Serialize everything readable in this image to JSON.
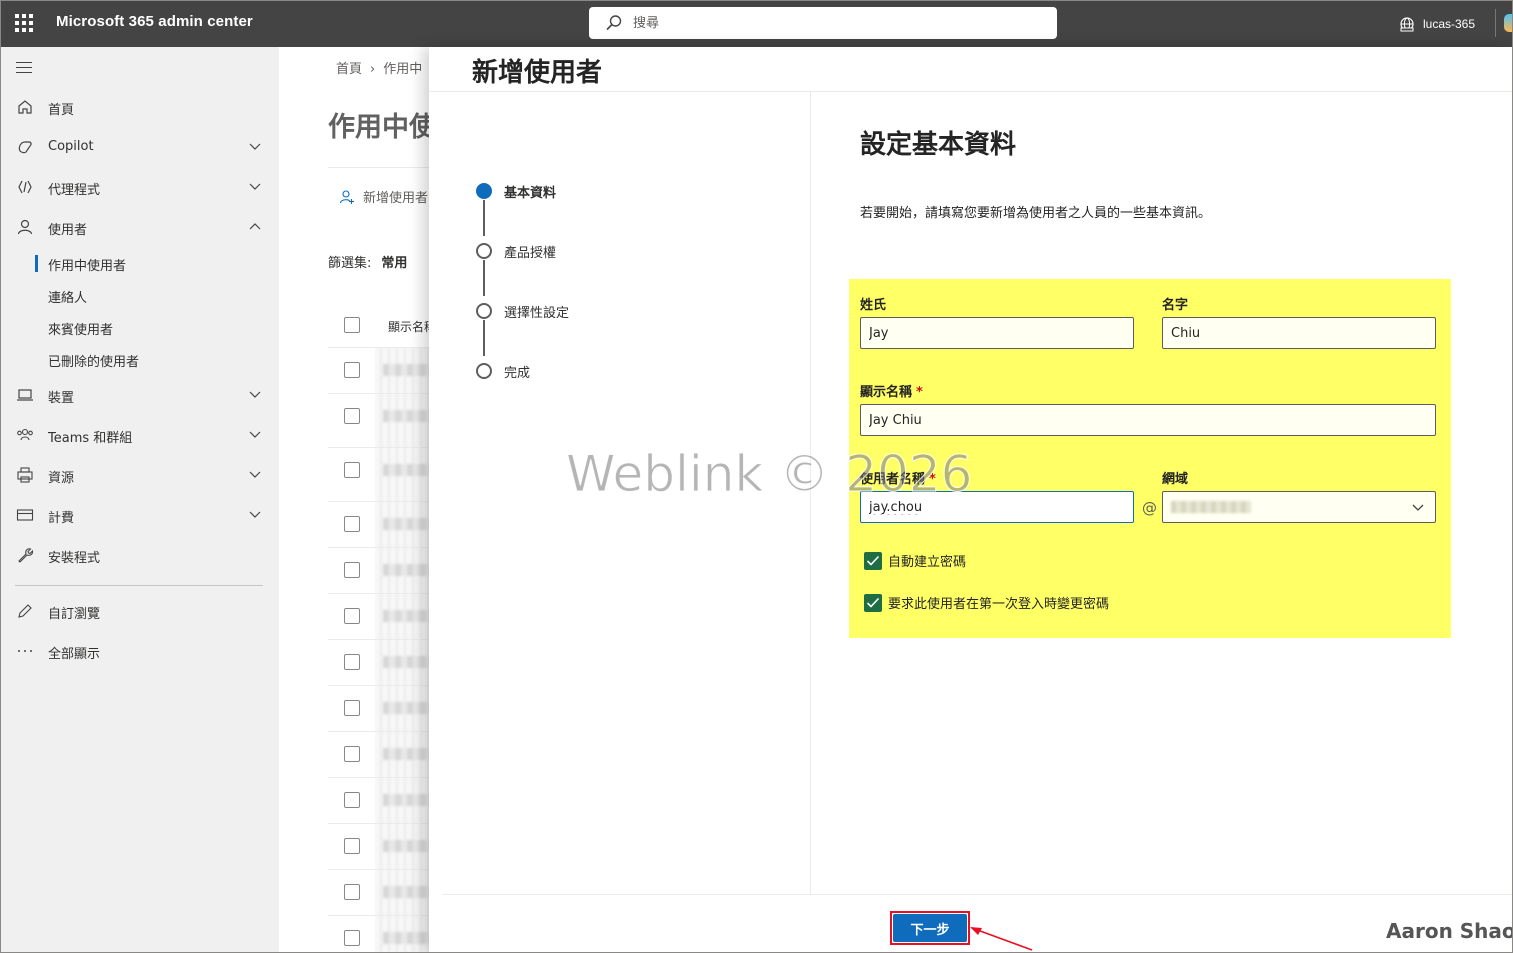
{
  "topbar": {
    "app_title": "Microsoft 365 admin center",
    "search_placeholder": "搜尋",
    "tenant": "lucas-365"
  },
  "nav": {
    "items": [
      {
        "label": "首頁",
        "icon": "home-icon"
      },
      {
        "label": "Copilot",
        "icon": "copilot-icon"
      },
      {
        "label": "代理程式",
        "icon": "agent-icon"
      },
      {
        "label": "使用者",
        "icon": "person-icon"
      },
      {
        "label": "裝置",
        "icon": "laptop-icon"
      },
      {
        "label": "Teams 和群組",
        "icon": "people-team-icon"
      },
      {
        "label": "資源",
        "icon": "printer-icon"
      },
      {
        "label": "計費",
        "icon": "credit-card-icon"
      },
      {
        "label": "安裝程式",
        "icon": "wrench-icon"
      },
      {
        "label": "自訂瀏覽",
        "icon": "pen-icon"
      },
      {
        "label": "全部顯示",
        "icon": "more-icon"
      }
    ],
    "users_sub": [
      "作用中使用者",
      "連絡人",
      "來賓使用者",
      "已刪除的使用者"
    ]
  },
  "background_page": {
    "breadcrumb_home": "首頁",
    "breadcrumb_current": "作用中",
    "title": "作用中使",
    "add_user": "新增使用者",
    "filter_label": "篩選集:",
    "filter_value": "常用",
    "column_display_name": "顯示名稱"
  },
  "panel": {
    "title": "新增使用者",
    "steps": [
      "基本資料",
      "產品授權",
      "選擇性設定",
      "完成"
    ],
    "form": {
      "heading": "設定基本資料",
      "description": "若要開始，請填寫您要新增為使用者之人員的一些基本資訊。",
      "first_name_label": "姓氏",
      "first_name_value": "Jay",
      "last_name_label": "名字",
      "last_name_value": "Chiu",
      "display_name_label": "顯示名稱",
      "display_name_value": "Jay Chiu",
      "username_label": "使用者名稱",
      "username_value": "jay.chou",
      "at_sign": "@",
      "domain_label": "網域",
      "required_mark": "*",
      "auto_password_label": "自動建立密碼",
      "require_change_label": "要求此使用者在第一次登入時變更密碼"
    },
    "next_button": "下一步"
  },
  "watermark": "Weblink © 2026",
  "author": "Aaron Shao",
  "colors": {
    "accent": "#0f6cbd",
    "highlight": "#ffff66",
    "checkbox": "#1f6e43",
    "callout": "#e81123"
  }
}
